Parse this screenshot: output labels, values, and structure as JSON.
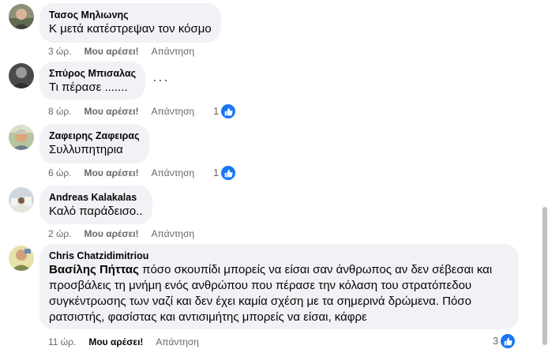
{
  "comments": [
    {
      "author": "Τασος Μηλιωνης",
      "text": "Κ μετά κατέστρεψαν τον κόσμο",
      "time": "3 ώρ.",
      "like_label": "Μου αρέσει!",
      "reply_label": "Απάντηση"
    },
    {
      "author": "Σπύρος Μπισαλας",
      "text": "Τι πέρασε .......",
      "time": "8 ώρ.",
      "like_label": "Μου αρέσει!",
      "reply_label": "Απάντηση",
      "reaction_count": "1",
      "more_options": "···"
    },
    {
      "author": "Ζαφειρης Ζαφειρας",
      "text": "Συλλυπητηρια",
      "time": "6 ώρ.",
      "like_label": "Μου αρέσει!",
      "reply_label": "Απάντηση",
      "reaction_count": "1"
    },
    {
      "author": "Andreas Kalakalas",
      "text": "Καλό παράδεισο..",
      "time": "2 ώρ.",
      "like_label": "Μου αρέσει!",
      "reply_label": "Απάντηση"
    },
    {
      "author": "Chris Chatzidimitriou",
      "mention": "Βασίλης Πήττας",
      "text": " πόσο σκουπίδι μπορείς να είσαι σαν άνθρωπος αν δεν σέβεσαι και προσβάλεις τη μνήμη ενός ανθρώπου που πέρασε την κόλαση του στρατόπεδου συγκέντρωσης των ναζί και δεν έχει καμία σχέση με τα σημερινά δρώμενα. Πόσο ρατσιστής, φασίστας και αντισιμήτης μπορείς να είσαι, κάφρε",
      "time": "11 ώρ.",
      "like_label": "Μου αρέσει!",
      "reply_label": "Απάντηση",
      "reaction_count": "3"
    }
  ],
  "colors": {
    "bubble": "#f0f2f5",
    "meta_text": "#65676b",
    "like_blue": "#1877f2",
    "like_active": "#050505"
  },
  "icons": {
    "like_reaction": "thumbs-up-icon",
    "more": "more-options-icon"
  }
}
